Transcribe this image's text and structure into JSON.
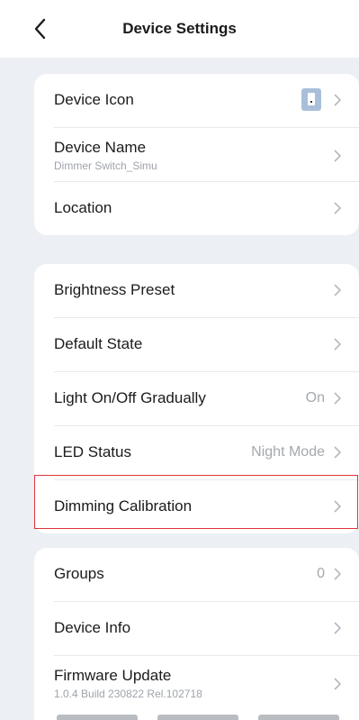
{
  "header": {
    "title": "Device Settings"
  },
  "groups": [
    {
      "rows": [
        {
          "label": "Device Icon"
        },
        {
          "label": "Device Name",
          "sub": "Dimmer Switch_Simu"
        },
        {
          "label": "Location"
        }
      ]
    },
    {
      "rows": [
        {
          "label": "Brightness Preset"
        },
        {
          "label": "Default State"
        },
        {
          "label": "Light On/Off Gradually",
          "value": "On"
        },
        {
          "label": "LED Status",
          "value": "Night Mode"
        },
        {
          "label": "Dimming Calibration"
        }
      ]
    },
    {
      "rows": [
        {
          "label": "Groups",
          "value": "0"
        },
        {
          "label": "Device Info"
        },
        {
          "label": "Firmware Update",
          "sub": "1.0.4 Build 230822 Rel.102718"
        }
      ]
    }
  ],
  "icons": {
    "back": "chevron-left-icon",
    "row_arrow": "chevron-right-icon",
    "device": "device-switch-icon"
  },
  "colors": {
    "highlight": "#e0343b",
    "device_icon_bg": "#a9bfd9"
  }
}
